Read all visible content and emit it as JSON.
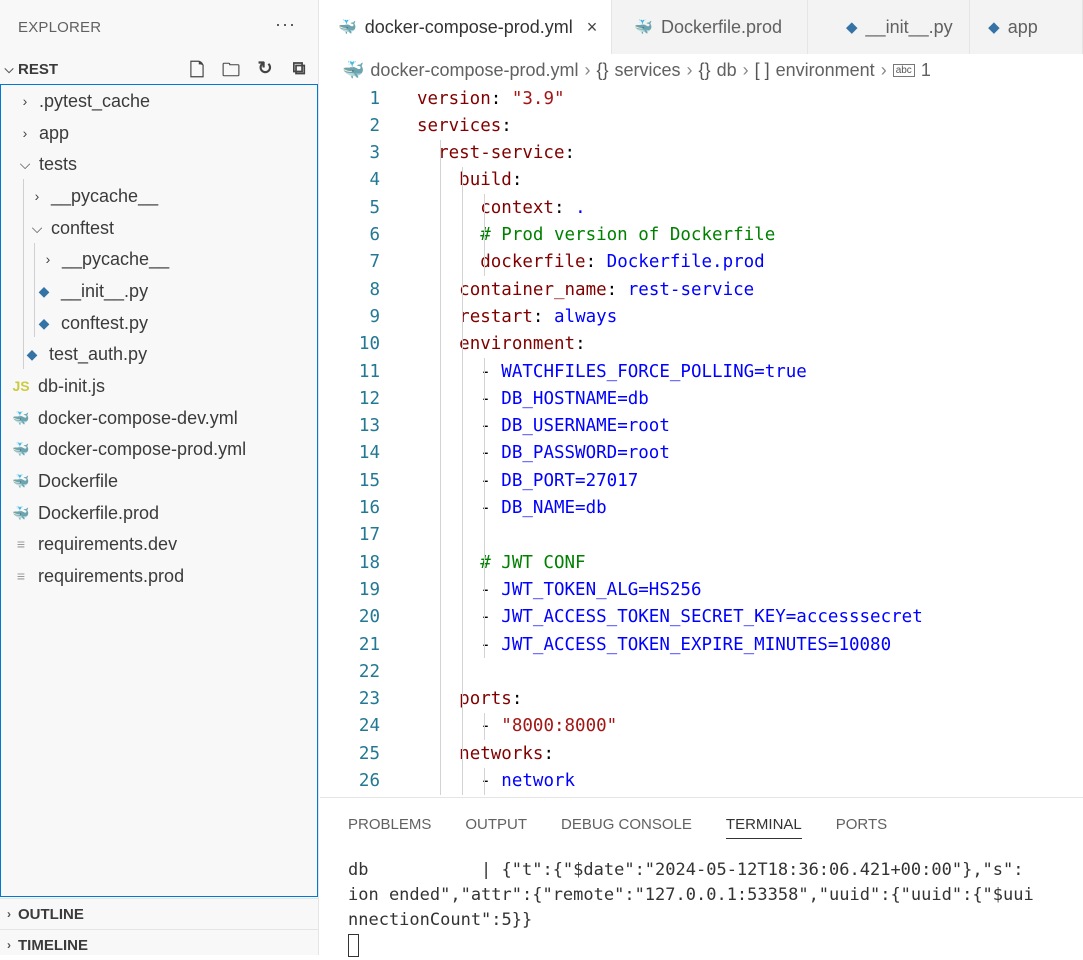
{
  "sidebar": {
    "title": "EXPLORER",
    "more_icon": "ellipsis-icon",
    "folder": "REST",
    "actions": [
      "new-file-icon",
      "new-folder-icon",
      "refresh-icon",
      "collapse-all-icon"
    ],
    "tree": [
      {
        "label": ".pytest_cache",
        "kind": "folder",
        "state": "collapsed"
      },
      {
        "label": "app",
        "kind": "folder",
        "state": "collapsed"
      },
      {
        "label": "tests",
        "kind": "folder",
        "state": "expanded"
      },
      {
        "label": "__pycache__",
        "kind": "folder",
        "state": "collapsed"
      },
      {
        "label": "conftest",
        "kind": "folder",
        "state": "expanded"
      },
      {
        "label": "__pycache__",
        "kind": "folder",
        "state": "collapsed"
      },
      {
        "label": "__init__.py",
        "kind": "python"
      },
      {
        "label": "conftest.py",
        "kind": "python"
      },
      {
        "label": "test_auth.py",
        "kind": "python"
      },
      {
        "label": "db-init.js",
        "kind": "javascript"
      },
      {
        "label": "docker-compose-dev.yml",
        "kind": "yaml"
      },
      {
        "label": "docker-compose-prod.yml",
        "kind": "yaml"
      },
      {
        "label": "Dockerfile",
        "kind": "docker"
      },
      {
        "label": "Dockerfile.prod",
        "kind": "docker"
      },
      {
        "label": "requirements.dev",
        "kind": "text"
      },
      {
        "label": "requirements.prod",
        "kind": "text"
      }
    ],
    "outline": "OUTLINE",
    "timeline": "TIMELINE"
  },
  "tabs": [
    {
      "label": "docker-compose-prod.yml",
      "active": true,
      "icon": "docker-compose-icon"
    },
    {
      "label": "Dockerfile.prod",
      "active": false,
      "icon": "docker-icon"
    },
    {
      "label": "__init__.py",
      "active": false,
      "icon": "python-icon"
    },
    {
      "label": "app",
      "active": false,
      "icon": "python-icon"
    }
  ],
  "breadcrumbs": {
    "file": "docker-compose-prod.yml",
    "services": "services",
    "db": "db",
    "environment": "environment",
    "item": "1",
    "object_glyph": "{}",
    "array_glyph": "[ ]"
  },
  "editor": {
    "lines": [
      "version: \"3.9\"",
      "services:",
      "  rest-service:",
      "    build:",
      "      context: .",
      "      # Prod version of Dockerfile",
      "      dockerfile: Dockerfile.prod",
      "    container_name: rest-service",
      "    restart: always",
      "    environment:",
      "      - WATCHFILES_FORCE_POLLING=true",
      "      - DB_HOSTNAME=db",
      "      - DB_USERNAME=root",
      "      - DB_PASSWORD=root",
      "      - DB_PORT=27017",
      "      - DB_NAME=db",
      "",
      "      # JWT CONF",
      "      - JWT_TOKEN_ALG=HS256",
      "      - JWT_ACCESS_TOKEN_SECRET_KEY=accesssecret",
      "      - JWT_ACCESS_TOKEN_EXPIRE_MINUTES=10080",
      "",
      "    ports:",
      "      - \"8000:8000\"",
      "    networks:",
      "      - network"
    ]
  },
  "panel": {
    "tabs": [
      "PROBLEMS",
      "OUTPUT",
      "DEBUG CONSOLE",
      "TERMINAL",
      "PORTS"
    ],
    "active_tab": "TERMINAL",
    "terminal_lines": [
      "db           | {\"t\":{\"$date\":\"2024-05-12T18:36:06.421+00:00\"},\"s\":",
      "ion ended\",\"attr\":{\"remote\":\"127.0.0.1:53358\",\"uuid\":{\"uuid\":{\"$uui",
      "nnectionCount\":5}}"
    ]
  }
}
